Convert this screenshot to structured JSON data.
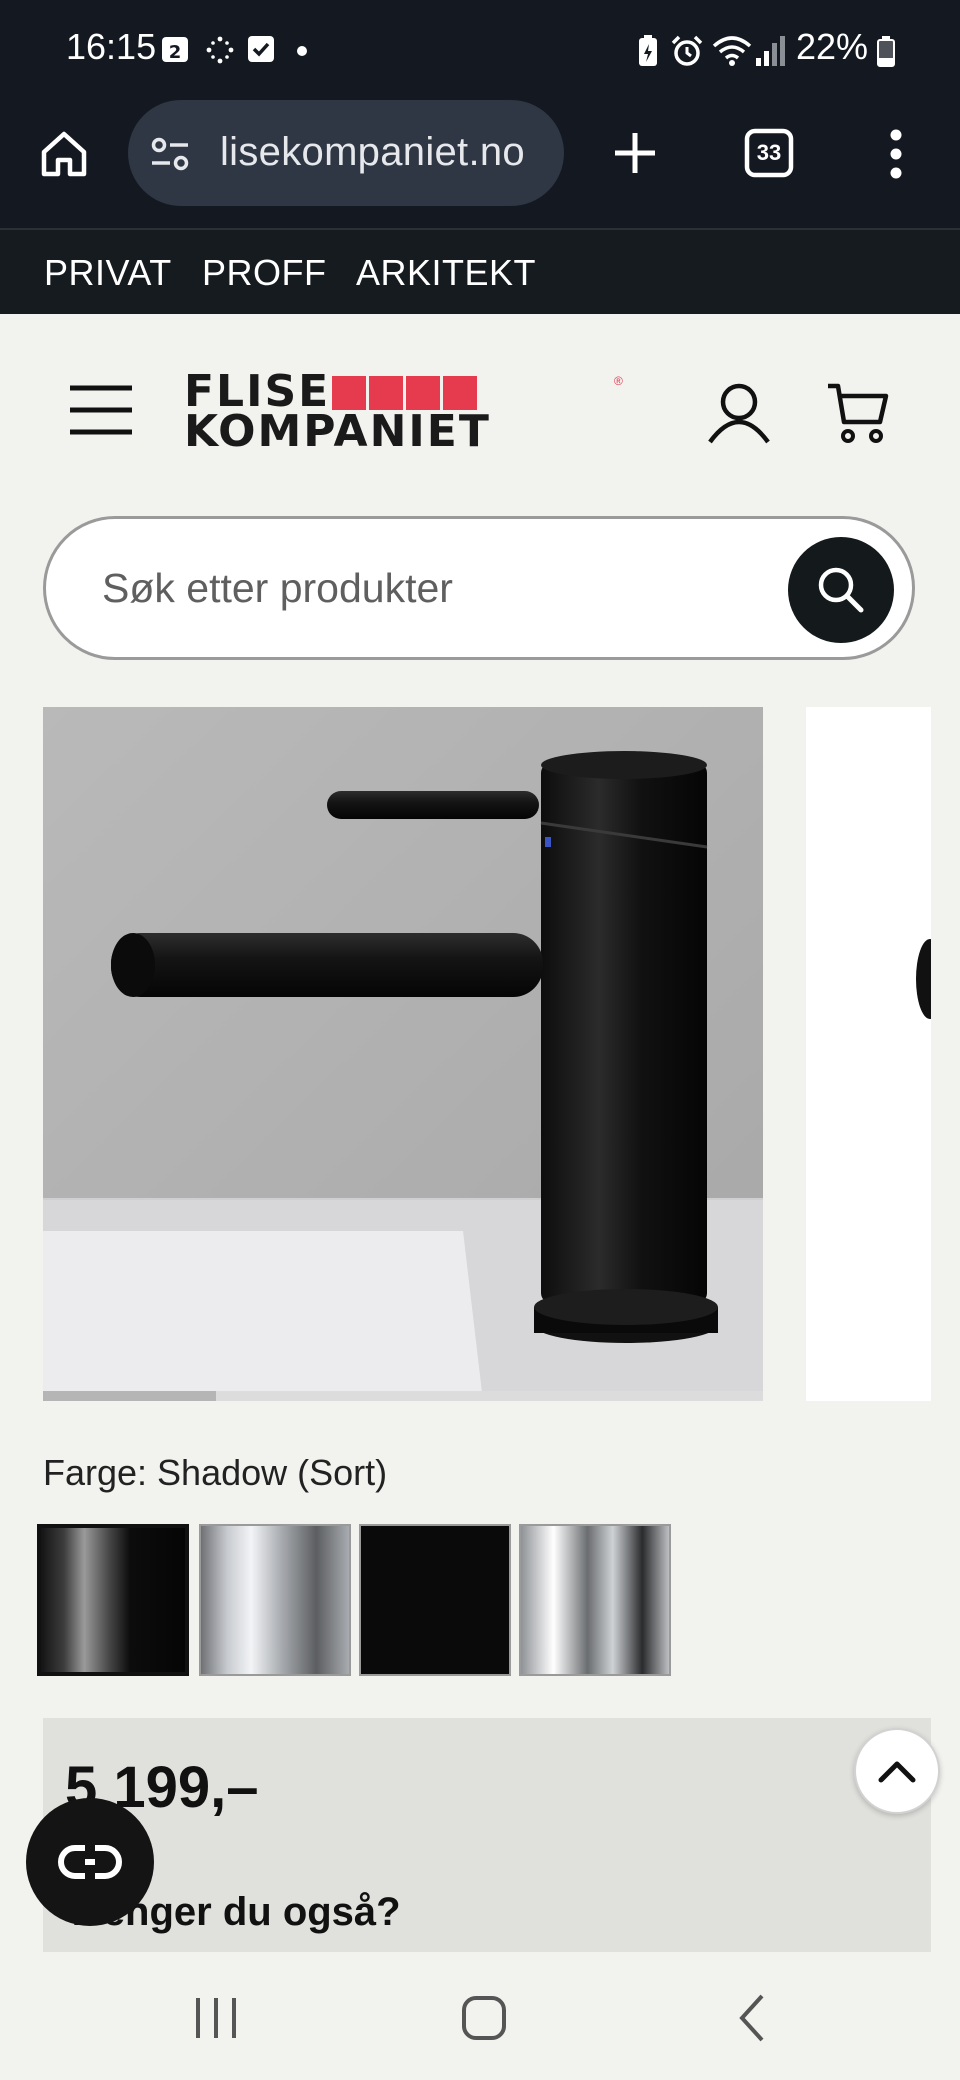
{
  "status_bar": {
    "time": "16:15",
    "notification_badge": "2",
    "battery": "22%"
  },
  "browser": {
    "url": "lisekompaniet.no",
    "tab_count": "33"
  },
  "segments": [
    "PRIVAT",
    "PROFF",
    "ARKITEKT"
  ],
  "brand": {
    "line1": "FLISE",
    "line2": "KOMPANIET",
    "accent_color": "#e63a4f"
  },
  "search": {
    "placeholder": "Søk etter produkter"
  },
  "product": {
    "color_label": "Farge: Shadow (Sort)",
    "swatches": [
      "Shadow (Sort)",
      "Krom",
      "Sort",
      "Krom blank"
    ],
    "selected_swatch": 0,
    "price": "5 199,–",
    "also_heading": "Trenger du også?"
  },
  "gallery": {
    "progress_fraction": 0.24
  }
}
